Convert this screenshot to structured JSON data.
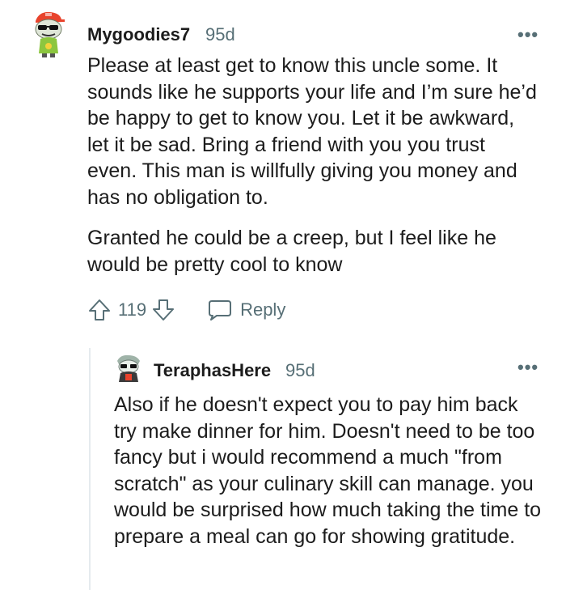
{
  "comment1": {
    "username": "Mygoodies7",
    "age": "95d",
    "more": "•••",
    "paragraph1": "Please at least get to know this uncle some. It sounds like he supports your life and I’m sure he’d be happy to get to know you. Let it be awkward, let it be sad. Bring a friend with you you trust even. This man is willfully giving you money and has no obligation to.",
    "paragraph2": "Granted he could be a creep, but I feel like he would be pretty cool to know",
    "votes": "119",
    "reply_label": "Reply"
  },
  "comment2": {
    "username": "TeraphasHere",
    "age": "95d",
    "more": "•••",
    "paragraph1": "Also if he doesn't expect you to pay him back try make dinner for him. Doesn't need to be too fancy but i would recommend a much \"from scratch\" as your culinary skill can manage. you would be surprised how much taking the time to prepare a meal can go for showing gratitude."
  },
  "colors": {
    "text": "#1c1c1c",
    "meta": "#576f76",
    "thread_line": "#e5ebee"
  },
  "icons": [
    "avatar",
    "upvote-icon",
    "downvote-icon",
    "comment-bubble-icon",
    "more-options-icon"
  ]
}
